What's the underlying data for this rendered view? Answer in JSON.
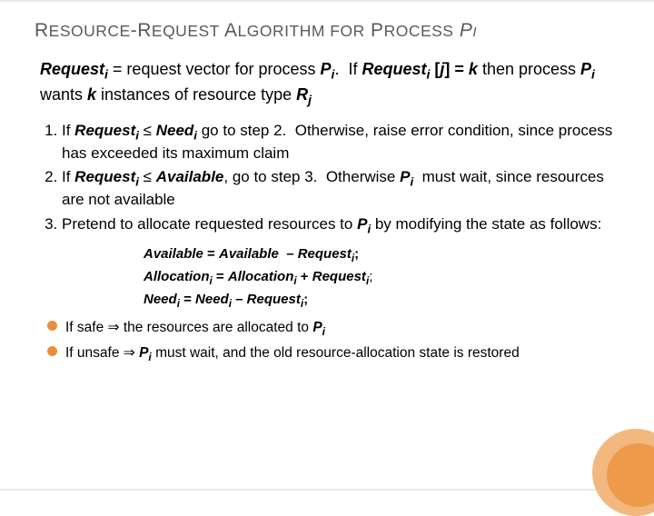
{
  "title_html": "R<small>ESOURCE</small>-R<small>EQUEST</small> A<small>LGORITHM FOR</small> P<small>ROCESS</small> <i>P<span class='sub'>i</span></i>",
  "intro_html": "<b><i>Request<span class='sub'>i</span></i></b> = request vector for process <i><b>P<span class='sub'>i</span></b></i>.&nbsp; If <b><i>Request<span class='sub'>i</span></i> [<i>j</i>] = <i>k</i></b> then process <i><b>P<span class='sub'>i</span></b></i> wants <i><b>k</b></i> instances of resource type <i><b>R<span class='sub'>j</span></b></i>",
  "steps": [
    "If <b><i>Request<span class='sub'>i</span></i></b> ≤ <b><i>Need<span class='sub'>i</span></i></b> go to step 2.&nbsp; Otherwise, raise error condition, since process has exceeded its maximum claim",
    "If <b><i>Request<span class='sub'>i</span></i></b> ≤ <b><i>Available</i></b>, go to step 3.&nbsp; Otherwise <i><b>P<span class='sub'>i</span></b></i>&nbsp; must wait, since resources are not available",
    "Pretend to allocate requested resources to <i><b>P<span class='sub'>i</span></b></i> by modifying the state as follows:"
  ],
  "equations": [
    "<b><i>Available</i> = <i>Available</i>&nbsp; – <i>Request<span class='sub'>i</span></i>;</b>",
    "<b><i>Allocation<span class='sub'>i</span></i> = <i>Allocation<span class='sub'>i</span></i> + <i>Request<span class='sub'>i</span></i></b>;",
    "<b><i>Need<span class='sub'>i</span></i> = <i>Need<span class='sub'>i</span></i> – <i>Request<span class='sub'>i</span></i>;</b>"
  ],
  "bullets": [
    "If safe ⇒ the resources are allocated to <i><b>P<span class='sub'>i</span></b></i>",
    "If unsafe ⇒ <i><b>P<span class='sub'>i</span></b></i> must wait, and the old resource-allocation state is restored"
  ]
}
